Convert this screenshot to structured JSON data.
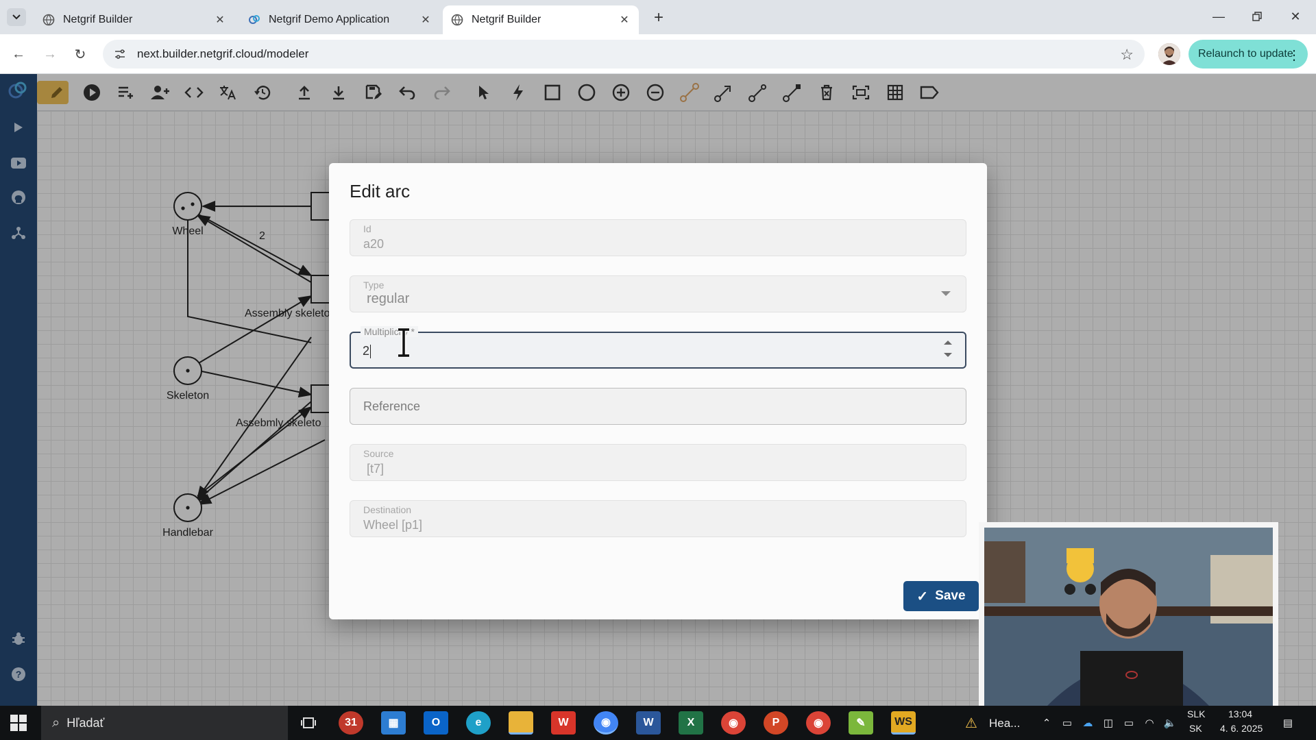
{
  "browser": {
    "tabs": [
      {
        "title": "Netgrif Builder",
        "active": false
      },
      {
        "title": "Netgrif Demo Application",
        "active": false
      },
      {
        "title": "Netgrif Builder",
        "active": true
      }
    ],
    "url": "next.builder.netgrif.cloud/modeler",
    "relaunch_label": "Relaunch to update"
  },
  "toolbar": {
    "icons": [
      "pencil-icon",
      "play-icon",
      "playlist-add-icon",
      "person-add-icon",
      "code-icon",
      "translate-icon",
      "history-icon",
      "upload-icon",
      "download-icon",
      "save-as-icon",
      "undo-icon",
      "redo-icon",
      "pointer-icon",
      "bolt-icon",
      "square-icon",
      "circle-icon",
      "plus-circle-icon",
      "minus-circle-icon",
      "arc-icon",
      "reset-arc-icon",
      "inhibitor-arc-icon",
      "read-arc-icon",
      "delete-icon",
      "fit-screen-icon",
      "grid-icon",
      "label-icon"
    ]
  },
  "sidebar": {
    "icons": [
      "netgrif-logo-icon",
      "play-icon",
      "video-icon",
      "github-icon",
      "share-icon",
      "bug-icon",
      "help-icon"
    ]
  },
  "canvas": {
    "places": [
      {
        "label": "Wheel"
      },
      {
        "label": "Skeleton"
      },
      {
        "label": "Handlebar"
      }
    ],
    "transitions": [
      {
        "label": "Assembly skeleto"
      },
      {
        "label": "Assebmly skeleto"
      }
    ],
    "arc_weight_label": "2"
  },
  "dialog": {
    "title": "Edit arc",
    "fields": {
      "id": {
        "label": "Id",
        "value": "a20"
      },
      "type": {
        "label": "Type",
        "value": "regular"
      },
      "multiplicity": {
        "label": "Multiplicity *",
        "value": "2"
      },
      "reference": {
        "placeholder": "Reference"
      },
      "source": {
        "label": "Source",
        "value": "[t7]"
      },
      "destination": {
        "label": "Destination",
        "value": "Wheel [p1]"
      }
    },
    "save_label": "Save"
  },
  "taskbar": {
    "search_placeholder": "Hľadať",
    "apps": [
      "task-view",
      "calendar",
      "microsoft-store",
      "outlook",
      "edge",
      "file-explorer",
      "wps",
      "chrome",
      "word",
      "excel",
      "chrome",
      "powerpoint",
      "chrome",
      "notepad-plus",
      "ws"
    ],
    "weather_text": "Hea...",
    "lang_top": "SLK",
    "lang_bottom": "SK",
    "time": "13:04",
    "date": "4. 6. 2025"
  },
  "colors": {
    "sidebar_bg": "#123a6b",
    "accent_yellow": "#f4c14c",
    "save_button": "#1b4f84",
    "relaunch_button": "#7fe0d6"
  }
}
